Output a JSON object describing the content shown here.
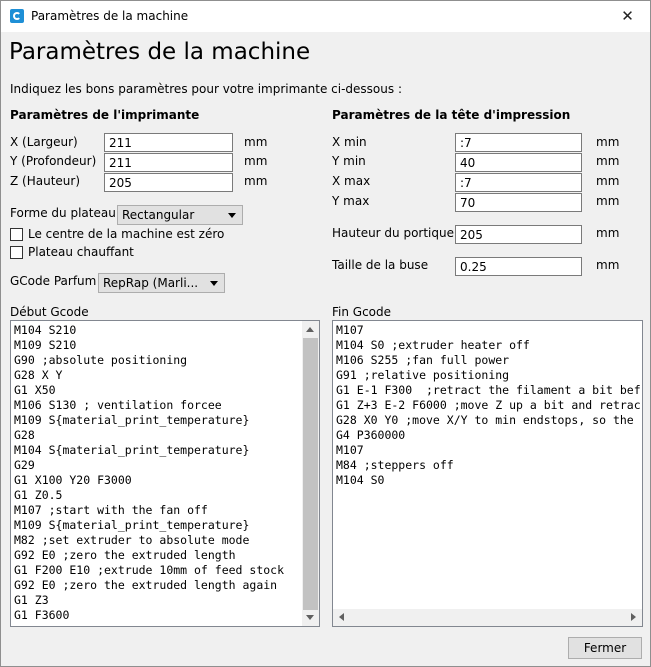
{
  "window": {
    "title": "Paramètres de la machine"
  },
  "heading": "Paramètres de la machine",
  "instructions": "Indiquez les bons paramètres pour votre imprimante ci-dessous :",
  "printer": {
    "section_title": "Paramètres de l'imprimante",
    "x_label": "X (Largeur)",
    "x_value": "211",
    "y_label": "Y (Profondeur)",
    "y_value": "211",
    "z_label": "Z (Hauteur)",
    "z_value": "205",
    "unit": "mm",
    "bed_shape_label": "Forme du plateau",
    "bed_shape_value": "Rectangular",
    "center_zero_label": "Le centre de la machine est zéro",
    "heated_bed_label": "Plateau chauffant",
    "gcode_flavor_label": "GCode Parfum",
    "gcode_flavor_value": "RepRap (Marli..."
  },
  "head": {
    "section_title": "Paramètres de la tête d'impression",
    "xmin_label": "X min",
    "xmin_value": ":7",
    "ymin_label": "Y min",
    "ymin_value": "40",
    "xmax_label": "X max",
    "xmax_value": ":7",
    "ymax_label": "Y max",
    "ymax_value": "70",
    "gantry_label": "Hauteur du portique",
    "gantry_value": "205",
    "nozzle_label": "Taille de la buse",
    "nozzle_value": "0.25",
    "unit": "mm"
  },
  "start_gcode": {
    "label": "Début Gcode",
    "text": "M104 S210\nM109 S210\nG90 ;absolute positioning\nG28 X Y\nG1 X50\nM106 S130 ; ventilation forcee\nM109 S{material_print_temperature}\nG28\nM104 S{material_print_temperature}\nG29\nG1 X100 Y20 F3000\nG1 Z0.5\nM107 ;start with the fan off\nM109 S{material_print_temperature}\nM82 ;set extruder to absolute mode\nG92 E0 ;zero the extruded length\nG1 F200 E10 ;extrude 10mm of feed stock\nG92 E0 ;zero the extruded length again\nG1 Z3\nG1 F3600"
  },
  "end_gcode": {
    "label": "Fin Gcode",
    "text": "M107\nM104 S0 ;extruder heater off\nM106 S255 ;fan full power\nG91 ;relative positioning\nG1 E-1 F300  ;retract the filament a bit bef\nG1 Z+3 E-2 F6000 ;move Z up a bit and retrac\nG28 X0 Y0 ;move X/Y to min endstops, so the\nG4 P360000\nM107\nM84 ;steppers off\nM104 S0"
  },
  "close_button": "Fermer"
}
